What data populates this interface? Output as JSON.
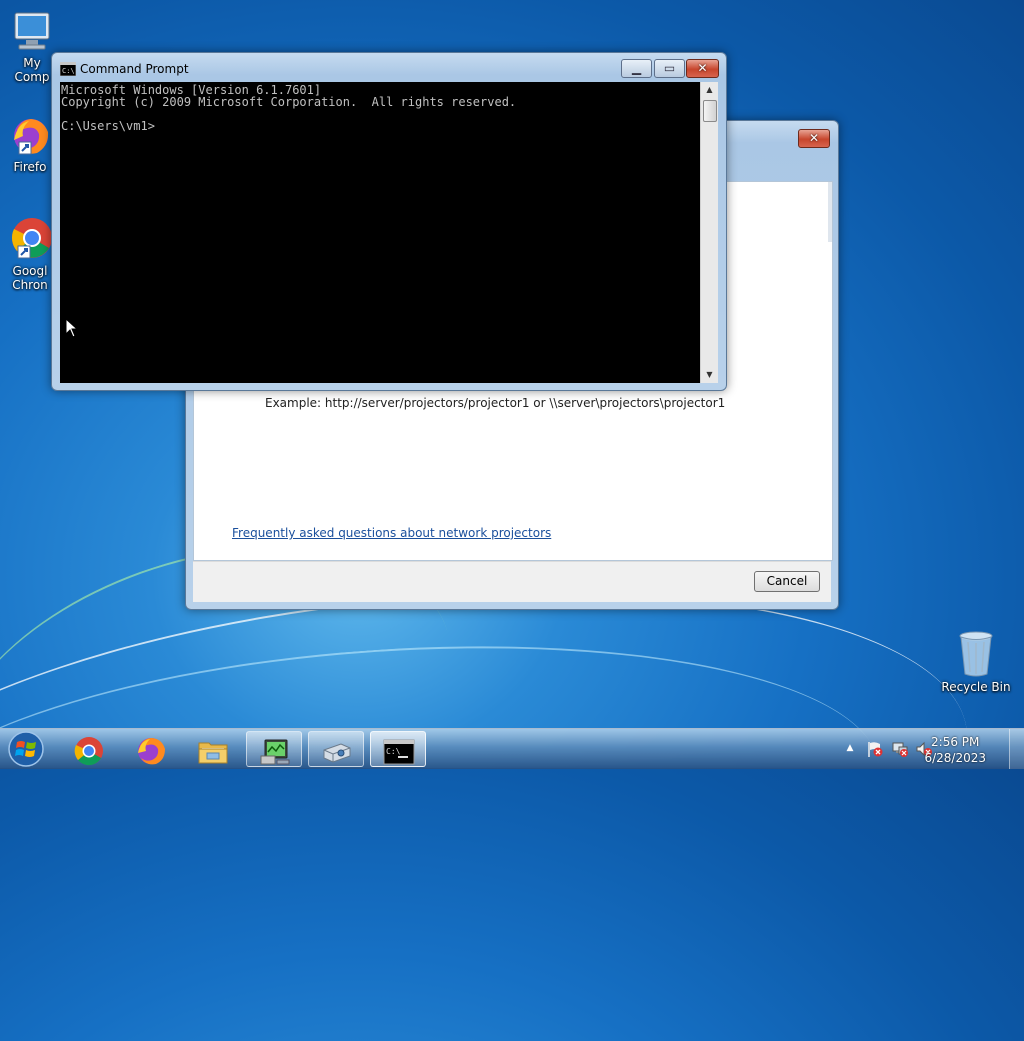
{
  "desktop": {
    "icons": [
      {
        "label": "My Computer",
        "visible_label": "My Comp"
      },
      {
        "label": "Firefox",
        "visible_label": "Firefo"
      },
      {
        "label": "Google Chrome",
        "visible_label_line1": "Googl",
        "visible_label_line2": "Chron"
      },
      {
        "label": "Recycle Bin"
      }
    ]
  },
  "cmd_window": {
    "title": "Command Prompt",
    "output": "Microsoft Windows [Version 6.1.7601]\nCopyright (c) 2009 Microsoft Corporation.  All rights reserved.\n\nC:\\Users\\vm1>"
  },
  "projector_dialog": {
    "example_text": "Example: http://server/projectors/projector1 or \\\\server\\projectors\\projector1",
    "faq_link": "Frequently asked questions about network projectors",
    "cancel_label": "Cancel"
  },
  "taskbar": {
    "buttons": [
      "start",
      "chrome",
      "firefox",
      "explorer",
      "network-monitor",
      "projector",
      "command-prompt"
    ],
    "clock_time": "2:56 PM",
    "clock_date": "6/28/2023"
  },
  "colors": {
    "accent": "#1670c4",
    "link": "#1a4f9c",
    "console_bg": "#000000",
    "console_fg": "#c0c0c0"
  }
}
